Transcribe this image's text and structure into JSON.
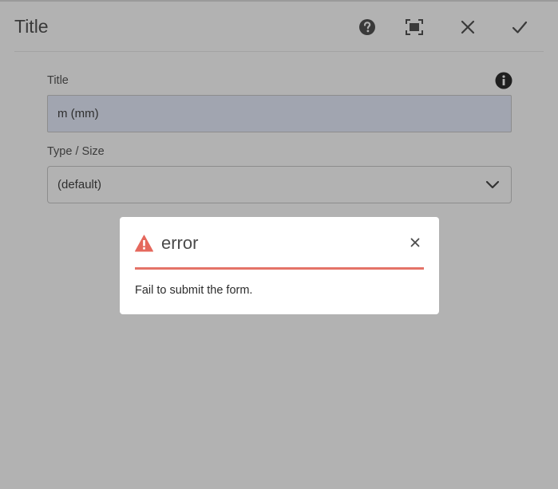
{
  "dialog": {
    "title": "Title",
    "actions": {
      "help_icon": "help-icon",
      "fullscreen_icon": "fullscreen-icon",
      "cancel_icon": "close-icon",
      "done_icon": "check-icon"
    }
  },
  "form": {
    "title_field": {
      "label": "Title",
      "value": "m (mm)",
      "info_icon": "info-icon"
    },
    "type_size_field": {
      "label": "Type / Size",
      "selected": "(default)",
      "chevron_icon": "chevron-down-icon"
    }
  },
  "error_popup": {
    "title": "error",
    "message": "Fail to submit the form.",
    "alert_icon": "alert-icon",
    "close_icon": "close-icon"
  },
  "colors": {
    "overlay_bg": "#b2b2b2",
    "popup_bg": "#ffffff",
    "error_accent": "#e47368",
    "input_bg": "#a1a5b0"
  }
}
